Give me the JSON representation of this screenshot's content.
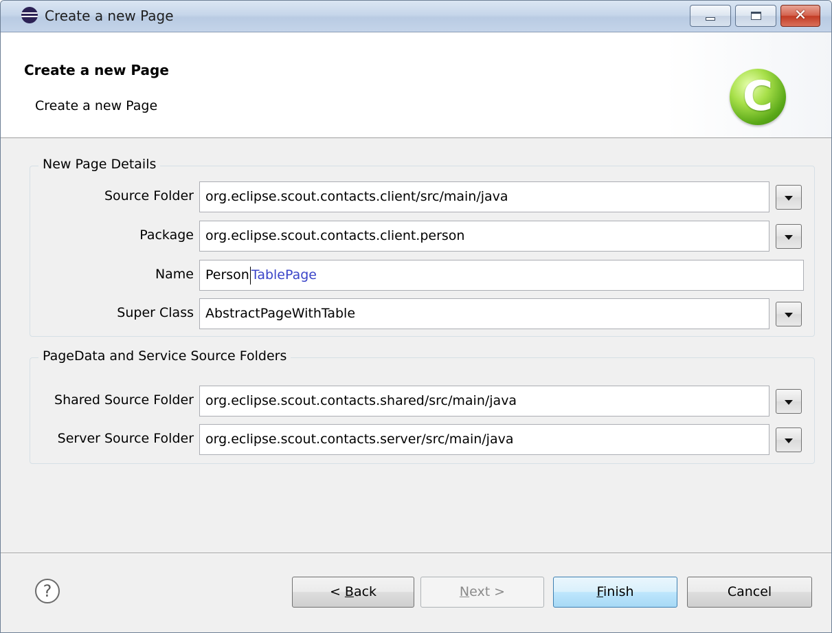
{
  "window": {
    "title": "Create a new Page"
  },
  "banner": {
    "title": "Create a new Page",
    "subtitle": "Create a new Page",
    "logo_letter": "C"
  },
  "details_group": {
    "legend": "New Page Details",
    "source_folder": {
      "label": "Source Folder",
      "value": "org.eclipse.scout.contacts.client/src/main/java"
    },
    "package": {
      "label": "Package",
      "value": "org.eclipse.scout.contacts.client.person"
    },
    "name": {
      "label": "Name",
      "typed": "Person",
      "suggestion": "TablePage"
    },
    "super_class": {
      "label": "Super Class",
      "value": "AbstractPageWithTable"
    }
  },
  "folders_group": {
    "legend": "PageData and Service Source Folders",
    "shared": {
      "label": "Shared Source Folder",
      "value": "org.eclipse.scout.contacts.shared/src/main/java"
    },
    "server": {
      "label": "Server Source Folder",
      "value": "org.eclipse.scout.contacts.server/src/main/java"
    }
  },
  "buttons": {
    "help": "?",
    "back_prefix": "< ",
    "back_mnemonic": "B",
    "back_rest": "ack",
    "next_mnemonic": "N",
    "next_rest": "ext >",
    "finish_mnemonic": "F",
    "finish_rest": "inish",
    "cancel": "Cancel"
  }
}
